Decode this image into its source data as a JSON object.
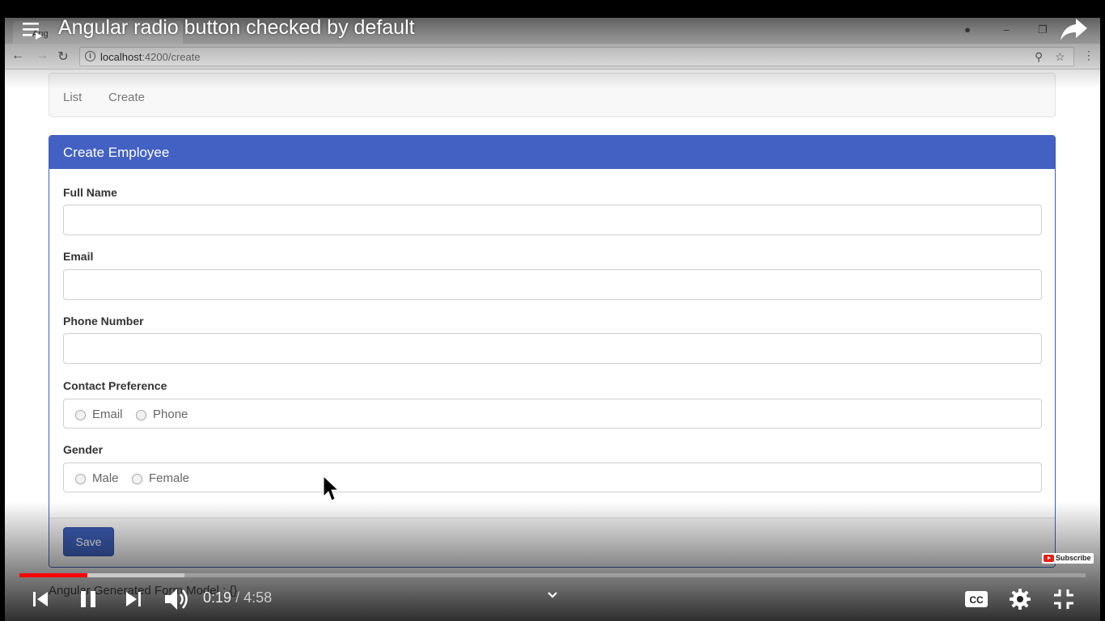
{
  "video": {
    "title": "Angular radio button checked by default",
    "current_time": "0:19",
    "separator": "/",
    "duration": "4:58",
    "progress_played": 0.064,
    "progress_buffered": 0.155,
    "subscribe_label": "Subscribe",
    "controls": [
      "previous-icon",
      "pause-icon",
      "next-icon",
      "volume-icon",
      "chevron-down-icon",
      "captions-icon",
      "gear-icon",
      "exit-fullscreen-icon"
    ]
  },
  "browser": {
    "tab_title": "Ang",
    "url_host": "localhost",
    "url_path": ":4200/create",
    "url_icons": [
      "zoom-icon",
      "star-icon",
      "menu-icon"
    ]
  },
  "nav": {
    "links": [
      "List",
      "Create"
    ]
  },
  "form": {
    "heading": "Create Employee",
    "fields": [
      {
        "label": "Full Name",
        "value": ""
      },
      {
        "label": "Email",
        "value": ""
      },
      {
        "label": "Phone Number",
        "value": ""
      }
    ],
    "contact_preference": {
      "label": "Contact Preference",
      "options": [
        "Email",
        "Phone"
      ],
      "selected": null
    },
    "gender": {
      "label": "Gender",
      "options": [
        "Male",
        "Female"
      ],
      "selected": null
    },
    "save_label": "Save"
  },
  "below_panel_text": "Angular Generated Form Model : {}",
  "colors": {
    "panel_heading": "#4361c2",
    "save_button": "#3d5fb8",
    "progress_played": "#ff0000"
  }
}
